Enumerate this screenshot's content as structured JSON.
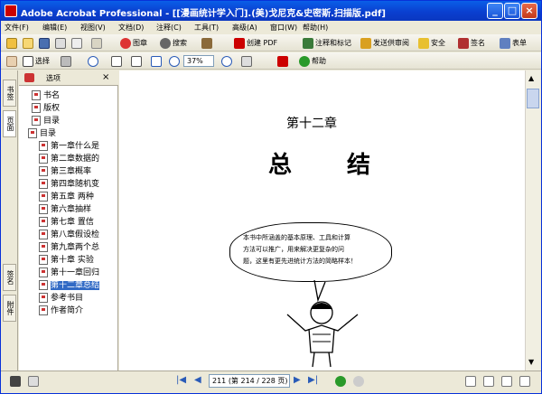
{
  "window": {
    "title": "Adobe Acrobat Professional - [[漫画统计学入门].(美)戈尼克&史密斯.扫描版.pdf]"
  },
  "title_buttons": [
    "_",
    "□",
    "×"
  ],
  "menu": [
    {
      "label": "文件(F)"
    },
    {
      "label": "编辑(E)"
    },
    {
      "label": "视图(V)"
    },
    {
      "label": "文档(D)"
    },
    {
      "label": "注释(C)"
    },
    {
      "label": "工具(T)"
    },
    {
      "label": "高级(A)"
    },
    {
      "label": "窗口(W)"
    },
    {
      "label": "帮助(H)"
    }
  ],
  "toolbar1": {
    "organize": "图章",
    "search": "搜索",
    "create_pdf": "创建 PDF",
    "comment": "注释和标记",
    "review": "发送供审阅",
    "secure": "安全",
    "sign": "签名",
    "forms": "表单"
  },
  "toolbar2": {
    "select": "选择",
    "zoom_value": "37%",
    "help": "帮助"
  },
  "nav": {
    "options": "选项",
    "close": "×",
    "tabs": [
      "书签",
      "页面",
      "签名",
      "附件"
    ],
    "bookmarks": [
      {
        "label": "书名"
      },
      {
        "label": "版权"
      },
      {
        "label": "目录"
      },
      {
        "label": "目录"
      },
      {
        "label": "第一章什么是"
      },
      {
        "label": "第二章数据的"
      },
      {
        "label": "第三章概率"
      },
      {
        "label": "第四章随机变"
      },
      {
        "label": "第五章  两种"
      },
      {
        "label": "第六章抽样"
      },
      {
        "label": "第七章  置信"
      },
      {
        "label": "第八章假设检"
      },
      {
        "label": "第九章两个总"
      },
      {
        "label": "第十章  实验"
      },
      {
        "label": "第十一章回归"
      },
      {
        "label": "第十二章总结"
      },
      {
        "label": "参考书目"
      },
      {
        "label": "作者简介"
      }
    ]
  },
  "document": {
    "chapter": "第十二章",
    "title_left": "总",
    "title_right": "结",
    "bubble_lines": [
      "本书中所涵盖的基本原理、工具和计算",
      "方法可以推广，用来解决更复杂的问",
      "题，这里有更先进统计方法的简略样本！"
    ]
  },
  "status": {
    "page": "211 (第 214 / 228 页)"
  }
}
